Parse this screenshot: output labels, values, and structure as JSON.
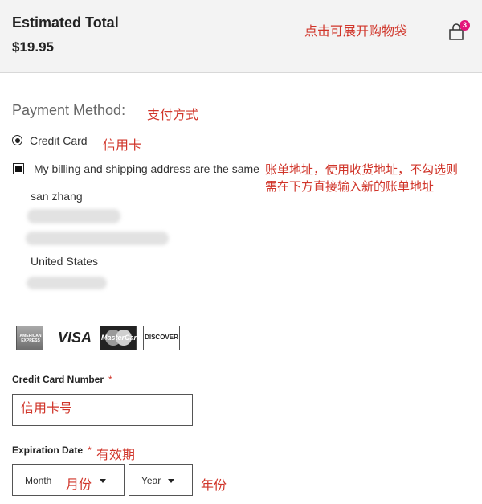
{
  "summary": {
    "total_label": "Estimated Total",
    "total_value": "$19.95",
    "bag_count": "3",
    "bag_icon": "shopping-bag-icon"
  },
  "payment": {
    "method_label": "Payment Method:",
    "credit_card_label": "Credit Card",
    "same_address_label": "My billing and shipping address are the same",
    "same_address_checked": true
  },
  "address": {
    "name": "san zhang",
    "country": "United States"
  },
  "cards": {
    "amex": "AMERICAN EXPRESS",
    "visa": "VISA",
    "mastercard": "MasterCard",
    "discover": "DISCOVER"
  },
  "form": {
    "card_number_label": "Credit Card Number",
    "required_mark": "*",
    "expiration_label": "Expiration Date",
    "month_label": "Month",
    "year_label": "Year"
  },
  "annotations": {
    "bag": "点击可展开购物袋",
    "payment_method": "支付方式",
    "credit_card": "信用卡",
    "billing_line1": "账单地址，使用收货地址，不勾选则",
    "billing_line2": "需在下方直接输入新的账单地址",
    "card_number": "信用卡号",
    "expiration": "有效期",
    "month": "月份",
    "year": "年份"
  },
  "colors": {
    "annotation": "#d0352a",
    "badge": "#e3157a",
    "header_bg": "#f3f3f3"
  }
}
